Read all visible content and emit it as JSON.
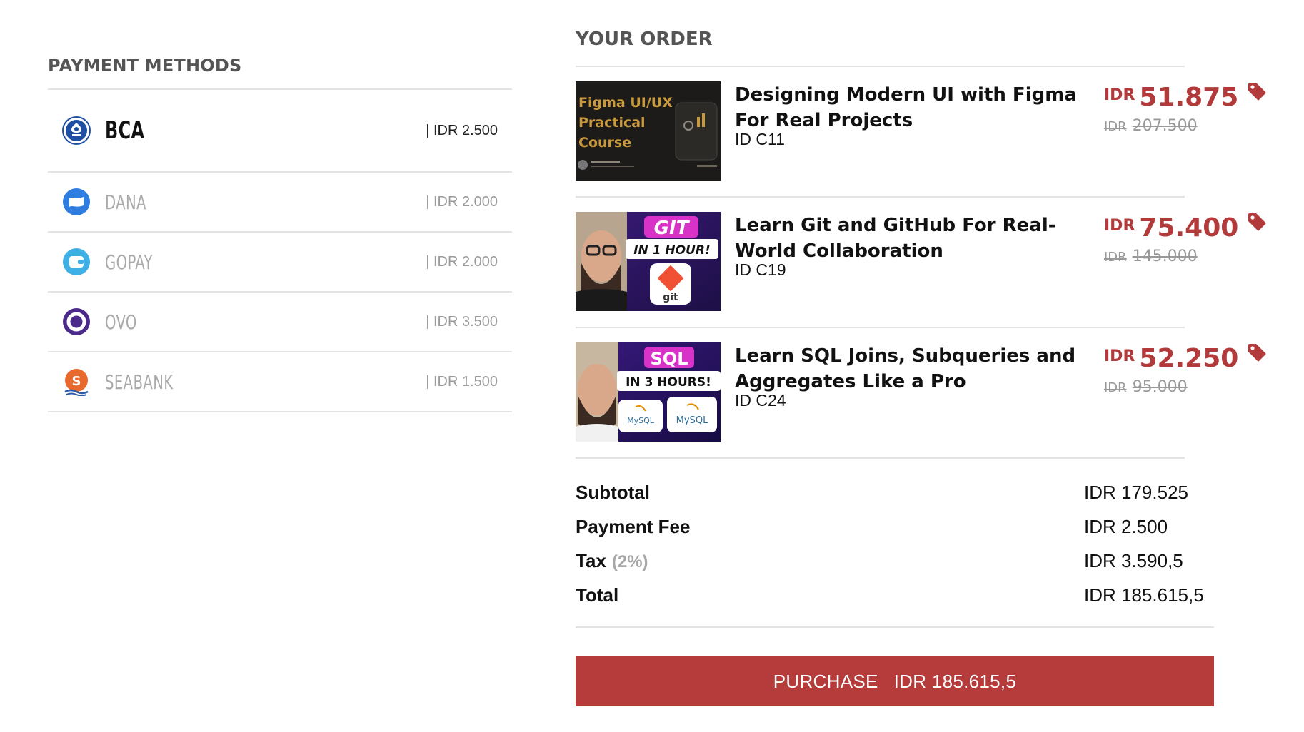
{
  "payment_methods": {
    "title": "PAYMENT METHODS",
    "items": [
      {
        "name": "BCA",
        "fee": "| IDR 2.500",
        "icon": "bca-logo-icon"
      },
      {
        "name": "DANA",
        "fee": "| IDR 2.000",
        "icon": "dana-logo-icon"
      },
      {
        "name": "GOPAY",
        "fee": "| IDR 2.000",
        "icon": "gopay-logo-icon"
      },
      {
        "name": "OVO",
        "fee": "| IDR 3.500",
        "icon": "ovo-logo-icon"
      },
      {
        "name": "SEABANK",
        "fee": "| IDR 1.500",
        "icon": "seabank-logo-icon"
      }
    ]
  },
  "order": {
    "title": "YOUR ORDER",
    "courses": [
      {
        "title": "Designing Modern UI with Figma For Real Projects",
        "id": "ID C11",
        "currency": "IDR",
        "price": "51.875",
        "old_currency": "IDR",
        "old_price": "207.500",
        "thumb_text": [
          "Figma UI/UX",
          "Practical",
          "Course"
        ]
      },
      {
        "title": "Learn Git and GitHub For Real-World Collaboration",
        "id": "ID C19",
        "currency": "IDR",
        "price": "75.400",
        "old_currency": "IDR",
        "old_price": "145.000",
        "thumb_text": [
          "GIT",
          "IN 1 HOUR!",
          "git"
        ]
      },
      {
        "title": "Learn SQL Joins, Subqueries and Aggregates Like a Pro",
        "id": "ID C24",
        "currency": "IDR",
        "price": "52.250",
        "old_currency": "IDR",
        "old_price": "95.000",
        "thumb_text": [
          "SQL",
          "IN 3 HOURS!",
          "MySQL",
          "MySQL"
        ]
      }
    ]
  },
  "summary": {
    "subtotal_label": "Subtotal",
    "subtotal_value": "IDR 179.525",
    "fee_label": "Payment Fee",
    "fee_value": "IDR 2.500",
    "tax_label": "Tax",
    "tax_note": "(2%)",
    "tax_value": "IDR 3.590,5",
    "total_label": "Total",
    "total_value": "IDR 185.615,5"
  },
  "purchase": {
    "label": "PURCHASE",
    "amount": "IDR 185.615,5"
  },
  "colors": {
    "accent": "#b53c3a",
    "price": "#b33a3a",
    "muted": "#999999",
    "divider": "#e3e3e3"
  }
}
